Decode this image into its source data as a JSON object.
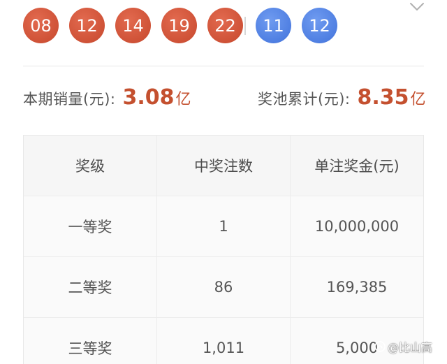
{
  "draw": {
    "red_balls": [
      "08",
      "12",
      "14",
      "19",
      "22"
    ],
    "blue_balls": [
      "11",
      "12"
    ]
  },
  "stats": {
    "sales_label": "本期销量(元):",
    "sales_value": "3.08",
    "sales_unit": "亿",
    "pool_label": "奖池累计(元):",
    "pool_value": "8.35",
    "pool_unit": "亿"
  },
  "prize_table": {
    "headers": [
      "奖级",
      "中奖注数",
      "单注奖金(元)"
    ],
    "rows": [
      [
        "一等奖",
        "1",
        "10,000,000"
      ],
      [
        "二等奖",
        "86",
        "169,385"
      ],
      [
        "三等奖",
        "1,011",
        "5,000"
      ]
    ]
  },
  "watermark": {
    "text": "@比山高"
  },
  "colors": {
    "red_ball": "#cf5237",
    "blue_ball": "#4f7fe2",
    "accent_value": "#c4502f"
  },
  "icons": {
    "expand": "chevron-down-icon",
    "watermark": "platform-logo-icon"
  }
}
